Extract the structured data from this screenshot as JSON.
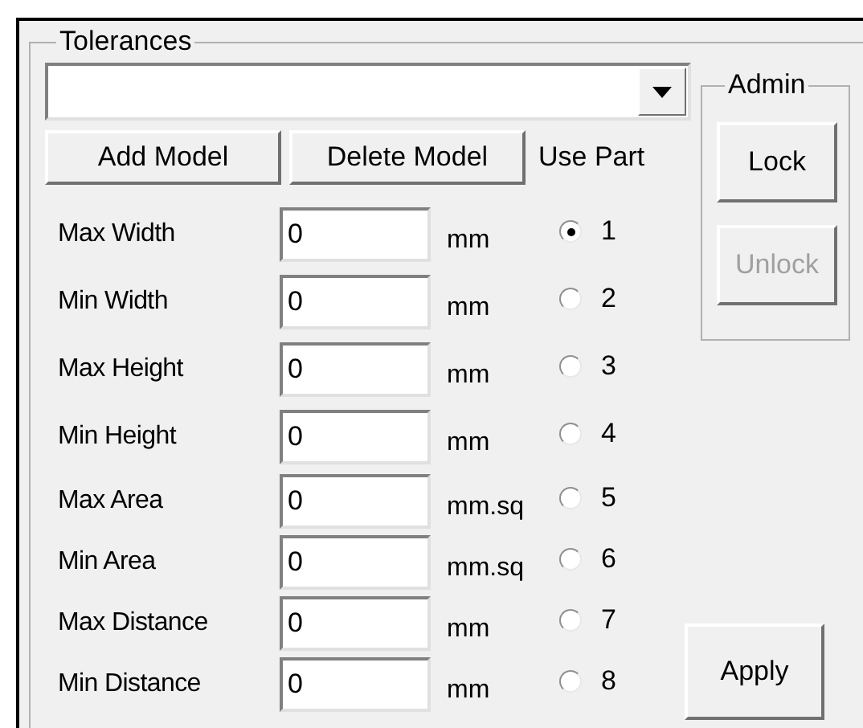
{
  "group": {
    "title": "Tolerances"
  },
  "model_buttons": [
    {
      "label": "Add Model"
    },
    {
      "label": "Delete Model"
    }
  ],
  "use_part_label": "Use Part",
  "rows": [
    {
      "label": "Max Width",
      "value": "0",
      "unit": "mm",
      "part": "1",
      "selected": true
    },
    {
      "label": "Min Width",
      "value": "0",
      "unit": "mm",
      "part": "2",
      "selected": false
    },
    {
      "label": "Max Height",
      "value": "0",
      "unit": "mm",
      "part": "3",
      "selected": false
    },
    {
      "label": "Min Height",
      "value": "0",
      "unit": "mm",
      "part": "4",
      "selected": false
    },
    {
      "label": "Max Area",
      "value": "0",
      "unit": "mm.sq",
      "part": "5",
      "selected": false
    },
    {
      "label": "Min Area",
      "value": "0",
      "unit": "mm.sq",
      "part": "6",
      "selected": false
    },
    {
      "label": "Max Distance",
      "value": "0",
      "unit": "mm",
      "part": "7",
      "selected": false
    },
    {
      "label": "Min Distance",
      "value": "0",
      "unit": "mm",
      "part": "8",
      "selected": false
    }
  ],
  "admin": {
    "title": "Admin",
    "buttons": [
      {
        "label": "Lock",
        "disabled": false
      },
      {
        "label": "Unlock",
        "disabled": true
      }
    ]
  },
  "apply": "Apply"
}
